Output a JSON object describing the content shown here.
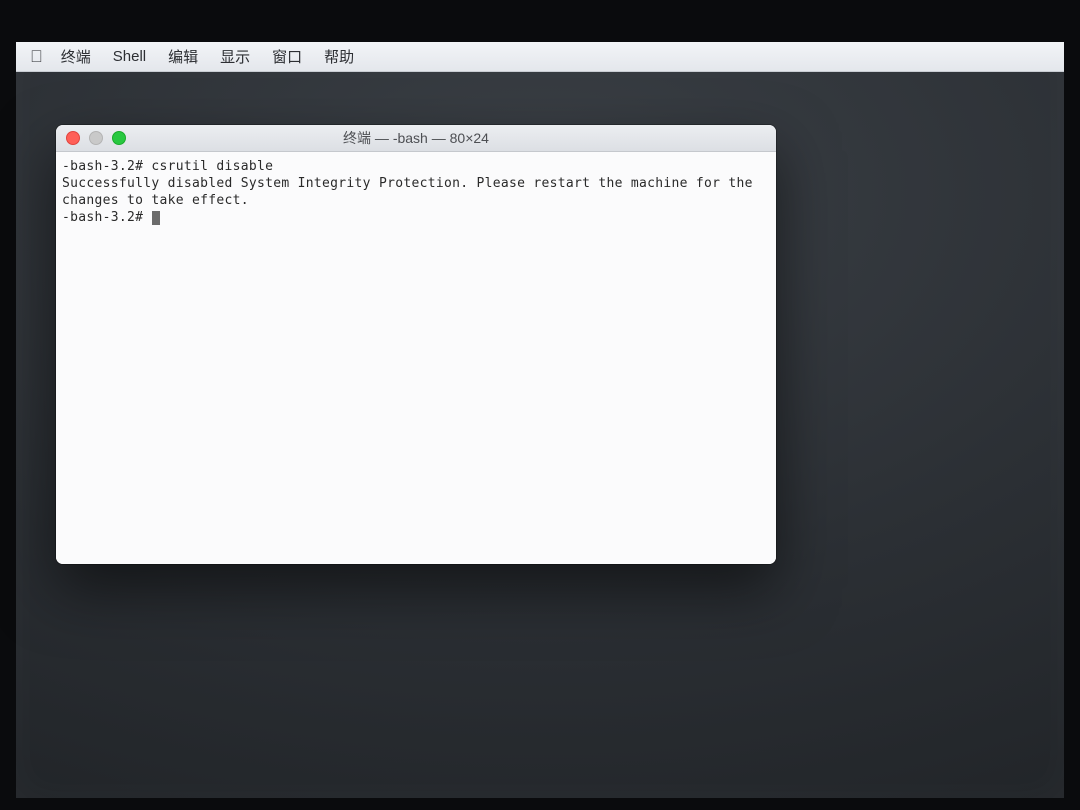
{
  "menubar": {
    "app": "终端",
    "items": [
      "Shell",
      "编辑",
      "显示",
      "窗口",
      "帮助"
    ]
  },
  "terminal": {
    "title": "终端 — -bash — 80×24",
    "prompt1": "-bash-3.2# ",
    "command1": "csrutil disable",
    "output": "Successfully disabled System Integrity Protection. Please restart the machine for the changes to take effect.",
    "prompt2": "-bash-3.2# "
  }
}
